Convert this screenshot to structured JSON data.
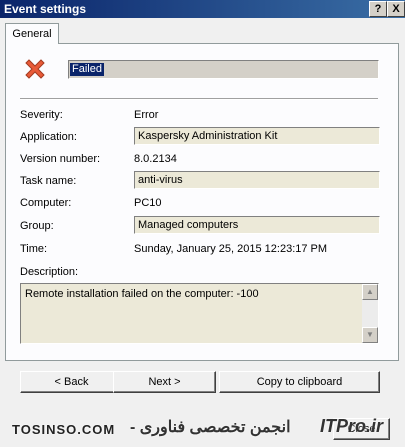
{
  "window": {
    "title": "Event settings",
    "help_label": "?",
    "close_label": "X"
  },
  "tabs": [
    {
      "label": "General"
    }
  ],
  "event": {
    "icon": "error-x-icon",
    "status": "Failed"
  },
  "fields": {
    "severity": {
      "label": "Severity:",
      "value": "Error"
    },
    "application": {
      "label": "Application:",
      "value": "Kaspersky Administration Kit"
    },
    "version": {
      "label": "Version number:",
      "value": "8.0.2134"
    },
    "task": {
      "label": "Task name:",
      "value": "anti-virus"
    },
    "computer": {
      "label": "Computer:",
      "value": "PC10"
    },
    "group": {
      "label": "Group:",
      "value": "Managed computers"
    },
    "time": {
      "label": "Time:",
      "value": "Sunday, January 25, 2015 12:23:17 PM"
    },
    "description": {
      "label": "Description:",
      "value": "Remote installation failed on the computer: -100"
    }
  },
  "buttons": {
    "back": "< Back",
    "next": "Next >",
    "copy": "Copy to clipboard",
    "close": "Close"
  },
  "watermark": {
    "left": "TOSINSO.COM",
    "middle": "انجمن تخصصی فناوری -",
    "right": "ITPro.ir"
  },
  "colors": {
    "titlebar_start": "#0a246a",
    "titlebar_end": "#3a6ea5",
    "error_icon": "#e85a38",
    "selection": "#0a246a"
  }
}
